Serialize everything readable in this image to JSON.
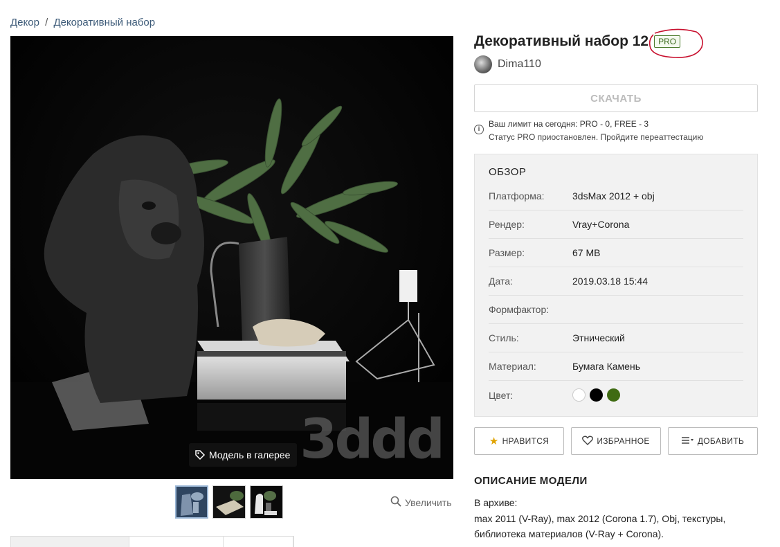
{
  "breadcrumb": {
    "root": "Декор",
    "separator": "/",
    "current": "Декоративный набор"
  },
  "product": {
    "title": "Декоративный набор 12",
    "badge": "PRO",
    "author": "Dima110"
  },
  "gallery": {
    "badge_label": "Модель в галерее",
    "watermark": "3ddd",
    "zoom_label": "Увеличить",
    "thumbnails": [
      "thumb-1",
      "thumb-2",
      "thumb-3"
    ],
    "active_thumbnail": 0
  },
  "download": {
    "label": "СКАЧАТЬ",
    "limit_text": "Ваш лимит на сегодня: PRO - 0, FREE - 3",
    "status_text": "Статус PRO приостановлен. Пройдите переаттестацию"
  },
  "overview": {
    "heading": "ОБЗОР",
    "rows": [
      {
        "label": "Платформа:",
        "value": "3dsMax 2012 + obj"
      },
      {
        "label": "Рендер:",
        "value": "Vray+Corona"
      },
      {
        "label": "Размер:",
        "value": "67 MB"
      },
      {
        "label": "Дата:",
        "value": "2019.03.18 15:44"
      },
      {
        "label": "Формфактор:",
        "value": ""
      },
      {
        "label": "Стиль:",
        "value": "Этнический"
      },
      {
        "label": "Материал:",
        "value": "Бумага Камень"
      },
      {
        "label": "Цвет:",
        "value": ""
      }
    ],
    "colors": [
      "#ffffff",
      "#000000",
      "#3f6b12"
    ]
  },
  "actions": {
    "like": "НРАВИТСЯ",
    "favorite": "ИЗБРАННОЕ",
    "add": "ДОБАВИТЬ"
  },
  "description": {
    "heading": "ОПИСАНИЕ МОДЕЛИ",
    "line1": "В архиве:",
    "line2": "max 2011 (V-Ray), max 2012 (Corona 1.7), Obj, текстуры,",
    "line3": "библиотека материалов (V-Ray + Corona)."
  },
  "icons": {
    "like": "star-icon",
    "favorite": "heart-icon",
    "add": "list-add-icon",
    "zoom": "magnifier-icon",
    "gallery": "tag-icon",
    "info": "info-icon"
  },
  "accent_colors": {
    "pro_badge": "#3d6b1f",
    "annotation": "#c8102e",
    "breadcrumb": "#3c5a78"
  }
}
